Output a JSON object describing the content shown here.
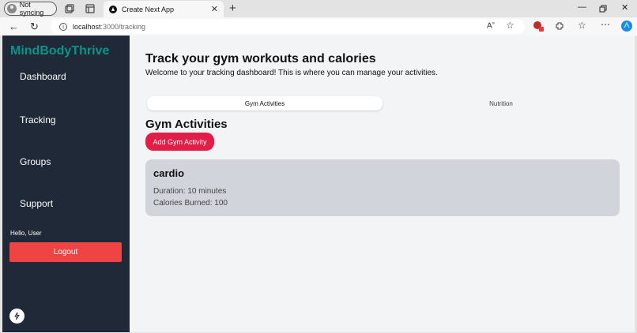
{
  "browser": {
    "sync_label": "Not syncing",
    "tab_title": "Create Next App",
    "url_host": "localhost",
    "url_rest": ":3000/tracking"
  },
  "sidebar": {
    "brand": "MindBodyThrive",
    "items": [
      {
        "label": "Dashboard"
      },
      {
        "label": "Tracking"
      },
      {
        "label": "Groups"
      },
      {
        "label": "Support"
      }
    ],
    "greeting": "Hello, User",
    "logout_label": "Logout"
  },
  "main": {
    "title": "Track your gym workouts and calories",
    "subtitle": "Welcome to your tracking dashboard! This is where you can manage your activities.",
    "tabs": [
      {
        "label": "Gym Activities",
        "active": true
      },
      {
        "label": "Nutrition",
        "active": false
      }
    ],
    "section_title": "Gym Activities",
    "add_button": "Add Gym Activity",
    "activities": [
      {
        "name": "cardio",
        "duration": "Duration: 10 minutes",
        "calories": "Calories Burned: 100"
      }
    ]
  },
  "colors": {
    "sidebar_bg": "#1f2937",
    "brand": "#0d9488",
    "logout": "#ef4444",
    "add_button": "#e11d48",
    "card_bg": "#d1d5db"
  }
}
